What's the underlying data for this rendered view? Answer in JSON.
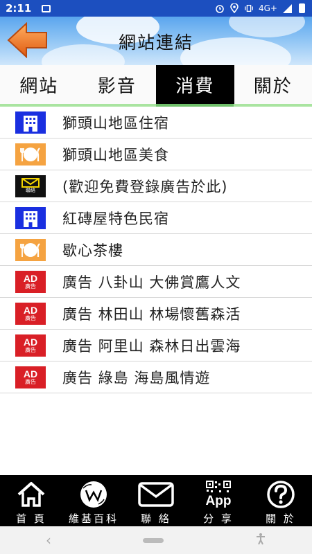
{
  "status_bar": {
    "time": "2:11",
    "network": "4G+"
  },
  "header": {
    "title": "網站連結",
    "back_icon": "back-arrow-icon"
  },
  "tabs": [
    {
      "label": "網站",
      "active": false
    },
    {
      "label": "影音",
      "active": false
    },
    {
      "label": "消費",
      "active": true
    },
    {
      "label": "關於",
      "active": false
    }
  ],
  "list": [
    {
      "icon": "hotel",
      "label": "獅頭山地區住宿"
    },
    {
      "icon": "food",
      "label": "獅頭山地區美食"
    },
    {
      "icon": "mail",
      "icon_text": "聯絡",
      "label": "(歡迎免費登錄廣告於此)"
    },
    {
      "icon": "hotel",
      "label": "紅磚屋特色民宿"
    },
    {
      "icon": "food",
      "label": "歇心茶樓"
    },
    {
      "icon": "ad",
      "icon_text": "廣告",
      "label": "廣告 八卦山 大佛賞鷹人文"
    },
    {
      "icon": "ad",
      "icon_text": "廣告",
      "label": "廣告 林田山 林場懷舊森活"
    },
    {
      "icon": "ad",
      "icon_text": "廣告",
      "label": "廣告 阿里山 森林日出雲海"
    },
    {
      "icon": "ad",
      "icon_text": "廣告",
      "label": "廣告 綠島 海島風情遊"
    }
  ],
  "ad_logo_text": "AD",
  "bottom_nav": [
    {
      "icon": "home-icon",
      "label": "首 頁"
    },
    {
      "icon": "wikipedia-icon",
      "label": "維基百科"
    },
    {
      "icon": "mail-icon",
      "label": "聯 絡"
    },
    {
      "icon": "qr-share-icon",
      "label": "分 享",
      "icon_text": "App"
    },
    {
      "icon": "help-icon",
      "label": "關 於"
    }
  ],
  "colors": {
    "status_bar": "#1c4fbf",
    "active_tab": "#000000",
    "tab_underline": "#a9e4a0",
    "hotel_icon": "#1a2fe0",
    "food_icon": "#f5a341",
    "ad_icon": "#d91f26",
    "back_arrow": "#f07a20"
  }
}
